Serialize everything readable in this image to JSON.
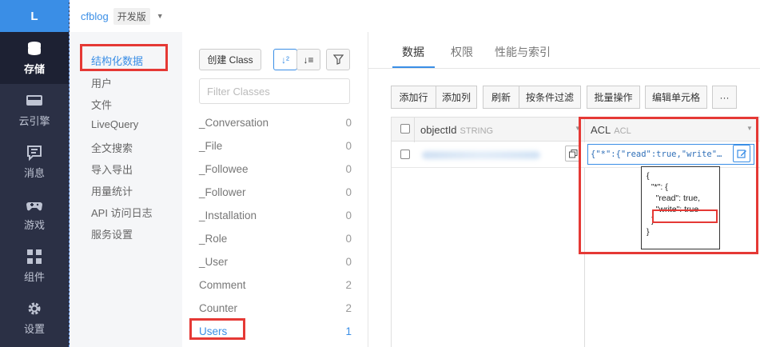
{
  "nav": {
    "logo": "L",
    "items": [
      {
        "label": "存储",
        "icon": "database-icon",
        "active": true
      },
      {
        "label": "云引擎",
        "icon": "cloud-engine-icon",
        "active": false
      },
      {
        "label": "消息",
        "icon": "message-icon",
        "active": false
      },
      {
        "label": "游戏",
        "icon": "gamepad-icon",
        "active": false
      },
      {
        "label": "组件",
        "icon": "components-icon",
        "active": false
      },
      {
        "label": "设置",
        "icon": "gear-icon",
        "active": false
      }
    ]
  },
  "topbar": {
    "app_name": "cfblog",
    "edition": "开发版"
  },
  "subnav": {
    "items": [
      "结构化数据",
      "用户",
      "文件",
      "LiveQuery",
      "全文搜索",
      "导入导出",
      "用量统计",
      "API 访问日志",
      "服务设置"
    ]
  },
  "classes": {
    "create_label": "创建 Class",
    "filter_placeholder": "Filter Classes",
    "list": [
      {
        "name": "_Conversation",
        "count": "0"
      },
      {
        "name": "_File",
        "count": "0"
      },
      {
        "name": "_Followee",
        "count": "0"
      },
      {
        "name": "_Follower",
        "count": "0"
      },
      {
        "name": "_Installation",
        "count": "0"
      },
      {
        "name": "_Role",
        "count": "0"
      },
      {
        "name": "_User",
        "count": "0"
      },
      {
        "name": "Comment",
        "count": "2"
      },
      {
        "name": "Counter",
        "count": "2"
      },
      {
        "name": "Users",
        "count": "1"
      }
    ]
  },
  "main": {
    "tabs": [
      "数据",
      "权限",
      "性能与索引"
    ],
    "toolbar": [
      "添加行",
      "添加列",
      "刷新",
      "按条件过滤",
      "批量操作",
      "编辑单元格",
      "···"
    ],
    "columns": [
      {
        "name": "objectId",
        "type": "STRING"
      },
      {
        "name": "ACL",
        "type": "ACL"
      }
    ],
    "acl_cell": "{\"*\":{\"read\":true,\"write\"…",
    "acl_popup": "{\n  \"*\": {\n    \"read\": true,\n    \"write\": true\n  }\n}"
  },
  "colors": {
    "accent": "#3a8ee6",
    "highlight": "#e53935",
    "nav_bg": "#2b3045"
  }
}
